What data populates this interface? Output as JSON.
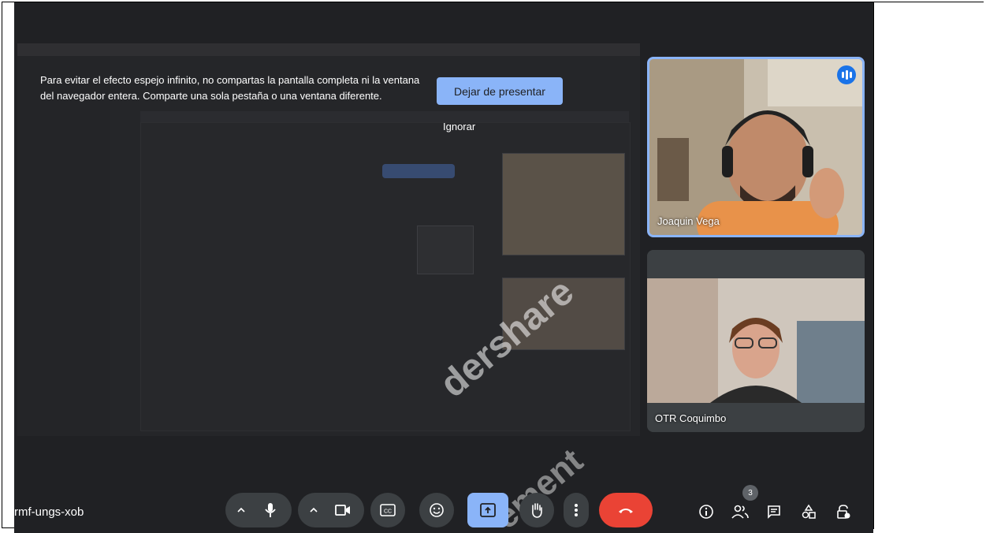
{
  "banner": {
    "message": "Para evitar el efecto espejo infinito, no compartas la pantalla completa ni la ventana del navegador entera. Comparte una sola pestaña o una ventana diferente.",
    "stop_presenting": "Dejar de presentar",
    "ignore": "Ignorar"
  },
  "participants": [
    {
      "name": "Joaquin Vega",
      "speaking": true
    },
    {
      "name": "OTR Coquimbo",
      "speaking": false
    }
  ],
  "meeting_code": "rmf-ungs-xob",
  "people_count": "3",
  "colors": {
    "accent": "#8ab4f8",
    "end_call": "#ea4335",
    "background": "#202124"
  },
  "watermark": {
    "line1": "dershare",
    "line2": "ement"
  },
  "toolbar_icons": [
    "chevron-up-icon",
    "mic-icon",
    "chevron-up-icon",
    "camera-icon",
    "captions-icon",
    "emoji-icon",
    "present-icon",
    "hand-icon",
    "more-icon",
    "end-call-icon"
  ],
  "side_icons": [
    "info-icon",
    "people-icon",
    "chat-icon",
    "activities-icon",
    "host-controls-icon"
  ]
}
